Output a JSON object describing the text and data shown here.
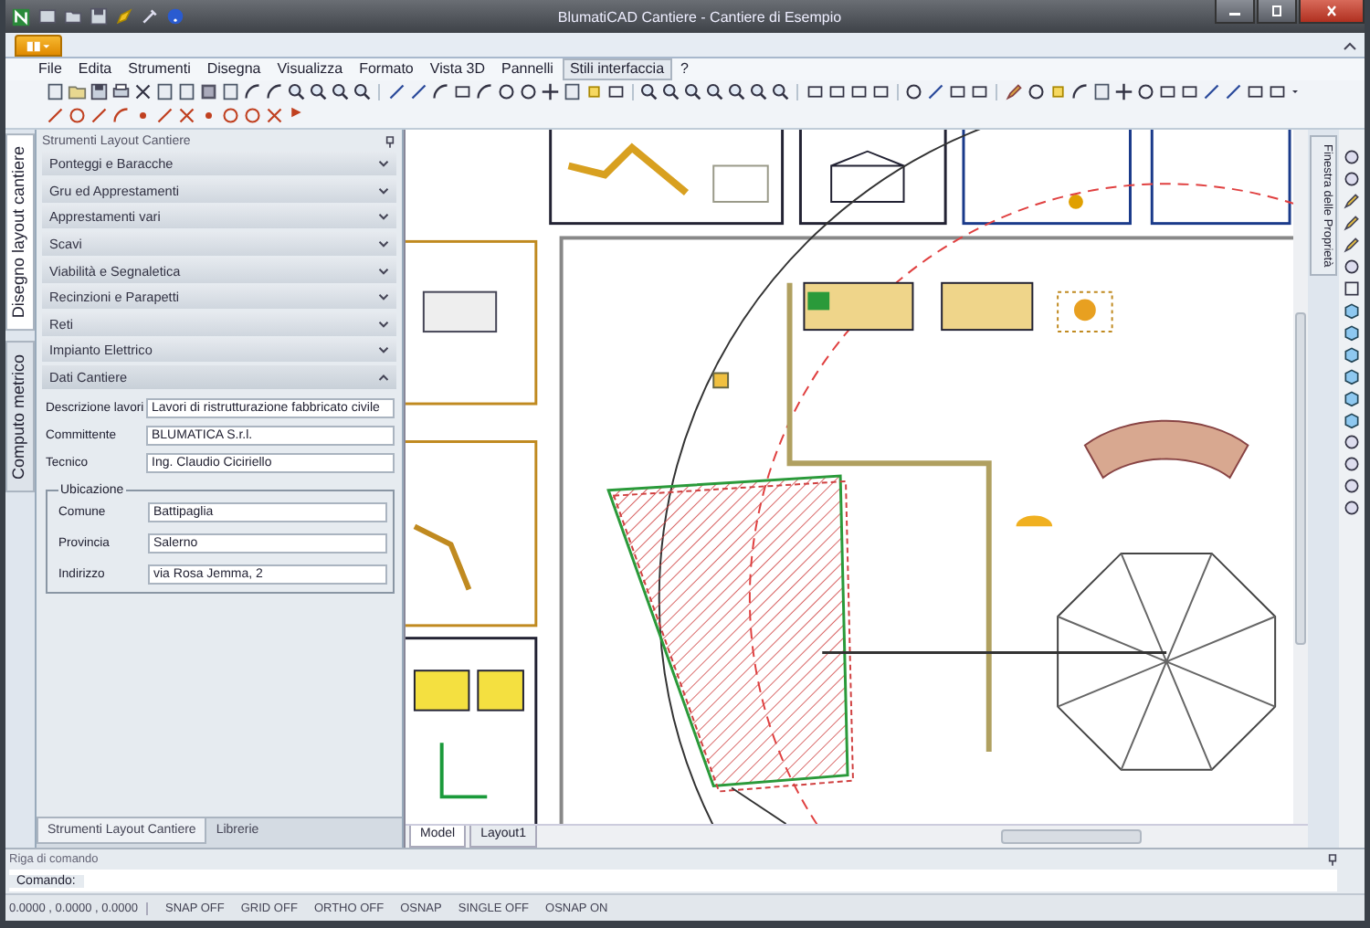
{
  "window": {
    "title": "BlumatiCAD Cantiere - Cantiere di Esempio"
  },
  "menu": [
    {
      "label": "File",
      "selected": false
    },
    {
      "label": "Edita",
      "selected": false
    },
    {
      "label": "Strumenti",
      "selected": false
    },
    {
      "label": "Disegna",
      "selected": false
    },
    {
      "label": "Visualizza",
      "selected": false
    },
    {
      "label": "Formato",
      "selected": false
    },
    {
      "label": "Vista 3D",
      "selected": false
    },
    {
      "label": "Pannelli",
      "selected": false
    },
    {
      "label": "Stili interfaccia",
      "selected": true
    },
    {
      "label": "?",
      "selected": false
    }
  ],
  "left_tabs": [
    {
      "label": "Disegno layout cantiere",
      "selected": true
    },
    {
      "label": "Computo metrico",
      "selected": false
    }
  ],
  "panel": {
    "title": "Strumenti Layout Cantiere",
    "sections": [
      {
        "label": "Ponteggi e Baracche",
        "expanded": false
      },
      {
        "label": "Gru ed Apprestamenti",
        "expanded": false
      },
      {
        "label": "Apprestamenti vari",
        "expanded": false
      },
      {
        "label": "Scavi",
        "expanded": false
      },
      {
        "label": "Viabilità e Segnaletica",
        "expanded": false
      },
      {
        "label": "Recinzioni e Parapetti",
        "expanded": false
      },
      {
        "label": "Reti",
        "expanded": false
      },
      {
        "label": "Impianto Elettrico",
        "expanded": false
      },
      {
        "label": "Dati Cantiere",
        "expanded": true
      }
    ],
    "fields": [
      {
        "label": "Descrizione lavori",
        "value": "Lavori di ristrutturazione fabbricato civile"
      },
      {
        "label": "Committente",
        "value": "BLUMATICA S.r.l."
      },
      {
        "label": "Tecnico",
        "value": "Ing. Claudio Ciciriello"
      }
    ],
    "group": {
      "title": "Ubicazione",
      "fields": [
        {
          "label": "Comune",
          "value": "Battipaglia"
        },
        {
          "label": "Provincia",
          "value": "Salerno"
        },
        {
          "label": "Indirizzo",
          "value": "via Rosa Jemma, 2"
        }
      ]
    },
    "bottom_tabs": [
      {
        "label": "Strumenti Layout Cantiere",
        "selected": true
      },
      {
        "label": "Librerie",
        "selected": false
      }
    ]
  },
  "canvas": {
    "tabs": [
      {
        "label": "Model",
        "selected": true
      },
      {
        "label": "Layout1",
        "selected": false
      }
    ]
  },
  "right_tab": {
    "label": "Finestra delle Proprietà"
  },
  "command": {
    "title": "Riga di comando",
    "label": "Comando:"
  },
  "status_bar": [
    "0.0000 , 0.0000 , 0.0000",
    "SNAP OFF",
    "GRID OFF",
    "ORTHO OFF",
    "OSNAP",
    "SINGLE OFF",
    "OSNAP ON"
  ]
}
